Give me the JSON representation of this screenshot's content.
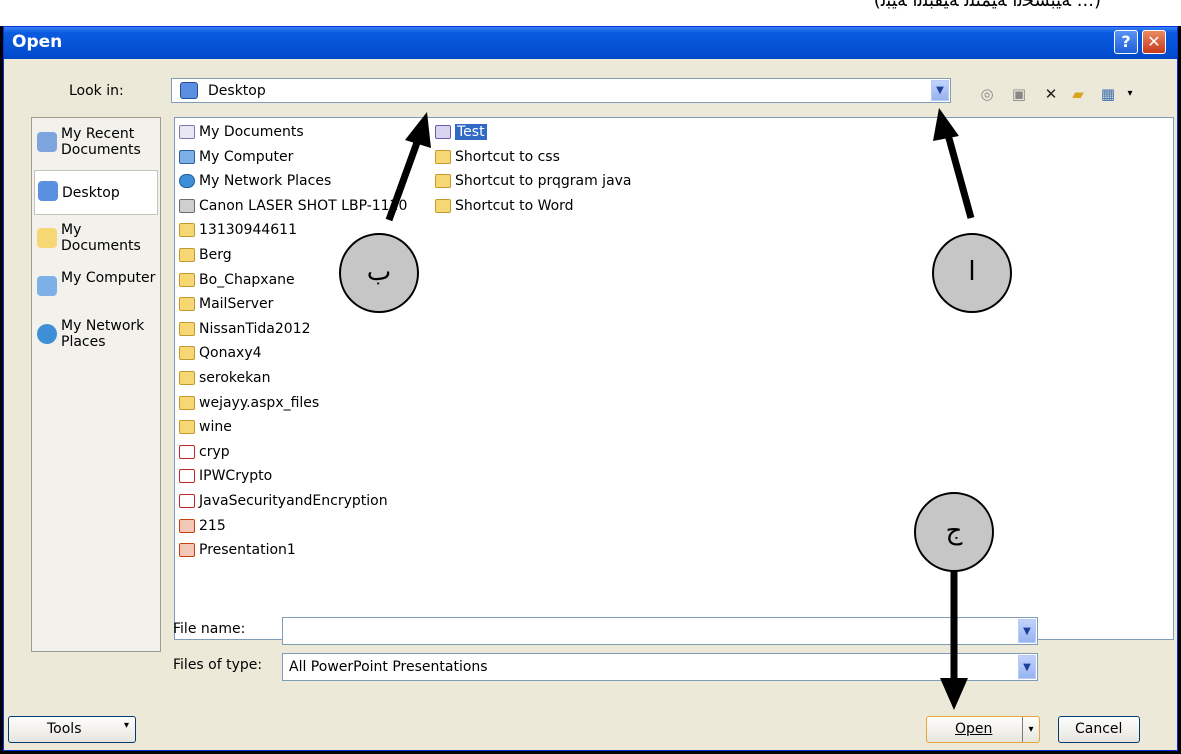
{
  "page_header_text": "(... ﺔﻴﺒﺴﺤﻟا ﺔﻴﻤﺘﻠﻟ ﺔﻴﻘﺒﻠﻟا ﺔﻴﺒﻟ)",
  "dialog": {
    "title": "Open",
    "help_label": "?",
    "close_label": "✕"
  },
  "look_in": {
    "label": "Look in:",
    "value": "Desktop"
  },
  "places": [
    {
      "label": "My Recent Documents",
      "icon": "recent-documents-icon"
    },
    {
      "label": "Desktop",
      "icon": "desktop-icon",
      "active": true
    },
    {
      "label": "My Documents",
      "icon": "my-documents-icon"
    },
    {
      "label": "My Computer",
      "icon": "my-computer-icon"
    },
    {
      "label": "My Network Places",
      "icon": "network-places-icon"
    }
  ],
  "files_col1": [
    {
      "name": "My Documents",
      "icon": "doc"
    },
    {
      "name": "My Computer",
      "icon": "pc"
    },
    {
      "name": "My Network Places",
      "icon": "net"
    },
    {
      "name": "Canon LASER SHOT LBP-1120",
      "icon": "printer"
    },
    {
      "name": "13130944611",
      "icon": "folder"
    },
    {
      "name": "Berg",
      "icon": "folder"
    },
    {
      "name": "Bo_Chapxane",
      "icon": "folder"
    },
    {
      "name": "MailServer",
      "icon": "folder"
    },
    {
      "name": "NissanTida2012",
      "icon": "folder"
    },
    {
      "name": "Qonaxy4",
      "icon": "folder"
    },
    {
      "name": "serokekan",
      "icon": "folder"
    },
    {
      "name": "wejayy.aspx_files",
      "icon": "folder"
    },
    {
      "name": "wine",
      "icon": "folder"
    },
    {
      "name": "cryp",
      "icon": "pdf"
    },
    {
      "name": "IPWCrypto",
      "icon": "pdf"
    },
    {
      "name": "JavaSecurityandEncryption",
      "icon": "pdf"
    },
    {
      "name": "215",
      "icon": "ppt"
    },
    {
      "name": "Presentation1",
      "icon": "ppt"
    }
  ],
  "files_col2": [
    {
      "name": "Test",
      "icon": "pptsel",
      "selected": true
    },
    {
      "name": "Shortcut to css",
      "icon": "sc"
    },
    {
      "name": "Shortcut to prqgram java",
      "icon": "sc"
    },
    {
      "name": "Shortcut to Word",
      "icon": "sc"
    }
  ],
  "file_name": {
    "label": "File name:",
    "value": ""
  },
  "files_of_type": {
    "label": "Files of type:",
    "value": "All PowerPoint Presentations"
  },
  "buttons": {
    "tools": "Tools",
    "open": "Open",
    "cancel": "Cancel"
  },
  "callouts": {
    "a": "ا",
    "b": "ب",
    "c": "ج"
  }
}
